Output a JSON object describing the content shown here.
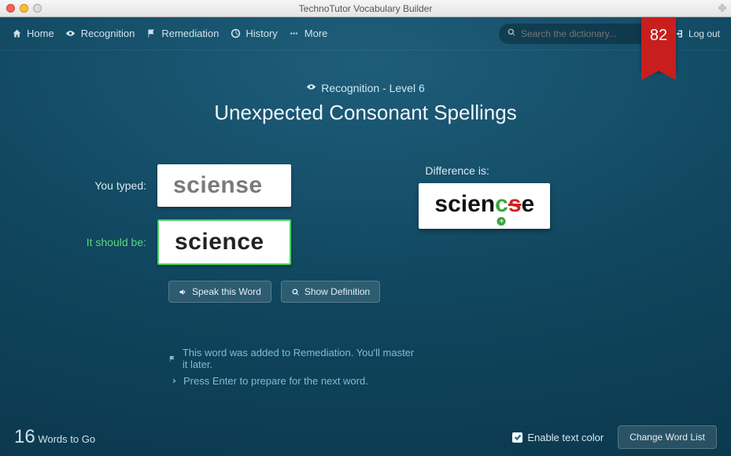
{
  "window_title": "TechnoTutor Vocabulary Builder",
  "nav": {
    "home": "Home",
    "recognition": "Recognition",
    "remediation": "Remediation",
    "history": "History",
    "more": "More",
    "logout": "Log out",
    "search_placeholder": "Search the dictionary..."
  },
  "ribbon": {
    "value": "82"
  },
  "heading": {
    "mode": "Recognition - Level 6",
    "title": "Unexpected Consonant Spellings"
  },
  "feedback": {
    "typed_label": "You typed:",
    "typed_value": "sciense",
    "should_label": "It should be:",
    "should_value": "science",
    "diff_label": "Difference is:"
  },
  "diff": {
    "parts": [
      {
        "text": "scien",
        "class": "l-equal"
      },
      {
        "text": "c",
        "class": "l-ins",
        "badge": "+"
      },
      {
        "text": "s",
        "class": "l-del"
      },
      {
        "text": "e",
        "class": "l-equal"
      }
    ]
  },
  "actions": {
    "speak": "Speak this Word",
    "define": "Show Definition"
  },
  "hints": {
    "line1": "This word was added to Remediation. You'll master it later.",
    "line2": "Press Enter to prepare for the next word."
  },
  "footer": {
    "count": "16",
    "count_label": "Words to Go",
    "enable_text_color": "Enable text color",
    "change_list": "Change Word List"
  }
}
